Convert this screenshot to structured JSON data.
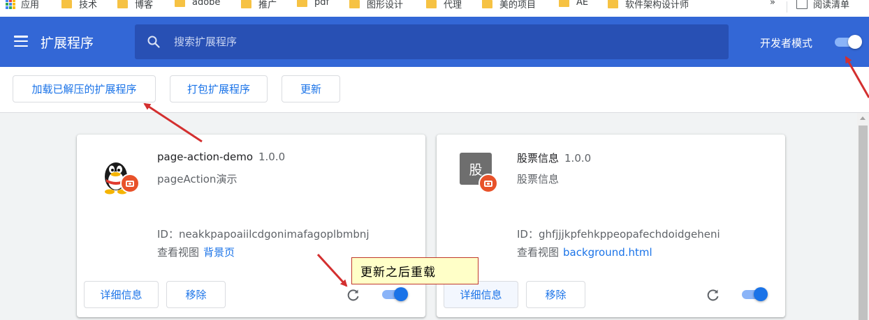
{
  "bookmarks": {
    "apps_label": "应用",
    "items": [
      "技术",
      "博客",
      "adobe",
      "推广",
      "pdf",
      "图形设计",
      "代理",
      "美的项目",
      "AE",
      "软件架构设计师"
    ],
    "more": "»",
    "reading_list": "阅读清单"
  },
  "header": {
    "title": "扩展程序",
    "search_placeholder": "搜索扩展程序",
    "dev_mode_label": "开发者模式",
    "dev_mode_on": true
  },
  "toolbar": {
    "load_unpacked": "加载已解压的扩展程序",
    "pack": "打包扩展程序",
    "update": "更新"
  },
  "extensions": [
    {
      "name": "page-action-demo",
      "version": "1.0.0",
      "description": "pageAction演示",
      "id_label": "ID：",
      "id": "neakkpapoaiilcdgonimafagoplbmbnj",
      "views_label": "查看视图",
      "view_link": "背景页",
      "details": "详细信息",
      "remove": "移除",
      "enabled": true
    },
    {
      "name": "股票信息",
      "version": "1.0.0",
      "description": "股票信息",
      "icon_text": "股",
      "id_label": "ID：",
      "id": "ghfjjjkpfehkppeopafechdoidgeheni",
      "views_label": "查看视图",
      "view_link": "background.html",
      "details": "详细信息",
      "remove": "移除",
      "enabled": true
    }
  ],
  "annotation": {
    "callout_text": "更新之后重载"
  },
  "colors": {
    "header_bg": "#3367d6",
    "accent": "#1a73e8",
    "annotation_red": "#d32f2f"
  }
}
